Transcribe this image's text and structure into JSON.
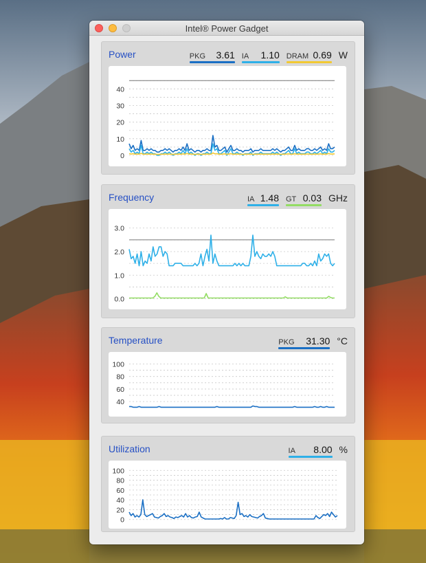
{
  "window": {
    "title": "Intel® Power Gadget"
  },
  "colors": {
    "pkg": "#1a6fc4",
    "ia": "#2eb0e8",
    "dram": "#f2c933",
    "gt": "#93dd63",
    "title_blue": "#2650c4"
  },
  "panels": {
    "power": {
      "title": "Power",
      "unit": "W",
      "readouts": [
        {
          "label": "PKG",
          "value": "3.61"
        },
        {
          "label": "IA",
          "value": "1.10"
        },
        {
          "label": "DRAM",
          "value": "0.69"
        }
      ],
      "chart_data": {
        "type": "line",
        "yticks": [
          "0",
          "10",
          "20",
          "30",
          "40"
        ],
        "ylim": [
          0,
          48
        ],
        "threshold": 45,
        "series": [
          {
            "key": "pkg",
            "values": [
              7,
              4,
              6,
              3,
              4,
              3,
              9,
              3,
              3,
              4,
              3,
              4,
              3,
              3,
              2,
              2,
              3,
              3,
              4,
              3,
              4,
              3,
              2,
              3,
              3,
              4,
              3,
              5,
              3,
              7,
              3,
              4,
              3,
              2,
              3,
              3,
              2,
              3,
              3,
              4,
              3,
              3,
              12,
              5,
              6,
              3,
              3,
              4,
              5,
              2,
              4,
              6,
              3,
              3,
              4,
              3,
              3,
              2,
              3,
              3,
              3,
              4,
              2,
              3,
              3,
              3,
              4,
              3,
              3,
              3,
              3,
              3,
              4,
              3,
              4,
              3,
              2,
              3,
              3,
              4,
              5,
              3,
              3,
              6,
              3,
              4,
              3,
              3,
              3,
              4,
              4,
              3,
              3,
              4,
              3,
              4,
              5,
              3,
              4,
              3,
              7,
              4,
              4,
              5
            ]
          },
          {
            "key": "ia",
            "values": [
              4,
              2,
              3,
              1,
              2,
              1,
              6,
              1,
              1,
              2,
              1,
              2,
              1,
              1,
              0,
              0,
              1,
              1,
              2,
              1,
              2,
              1,
              0,
              1,
              1,
              2,
              1,
              3,
              1,
              4,
              1,
              2,
              1,
              0,
              1,
              1,
              0,
              1,
              1,
              2,
              1,
              1,
              7,
              3,
              4,
              1,
              1,
              2,
              3,
              0,
              2,
              4,
              1,
              1,
              2,
              1,
              1,
              0,
              1,
              1,
              1,
              2,
              0,
              1,
              1,
              1,
              2,
              1,
              1,
              1,
              1,
              1,
              2,
              1,
              2,
              1,
              0,
              1,
              1,
              2,
              3,
              1,
              1,
              4,
              1,
              2,
              1,
              1,
              1,
              2,
              2,
              1,
              1,
              2,
              1,
              2,
              3,
              1,
              2,
              1,
              4,
              2,
              2,
              3
            ]
          },
          {
            "key": "dram",
            "values": [
              1,
              0.8,
              1,
              0.7,
              0.8,
              0.7,
              1.2,
              0.7,
              0.7,
              0.8,
              0.7,
              0.8,
              0.7,
              0.7,
              0.6,
              0.6,
              0.7,
              0.7,
              0.8,
              0.7,
              0.8,
              0.7,
              0.6,
              0.7,
              0.7,
              0.8,
              0.7,
              0.9,
              0.7,
              1.1,
              0.7,
              0.8,
              0.7,
              0.6,
              0.7,
              0.7,
              0.6,
              0.7,
              0.7,
              0.8,
              0.7,
              0.7,
              1.5,
              0.9,
              1,
              0.7,
              0.7,
              0.8,
              0.9,
              0.6,
              0.8,
              1,
              0.7,
              0.7,
              0.8,
              0.7,
              0.7,
              0.6,
              0.7,
              0.7,
              0.7,
              0.8,
              0.6,
              0.7,
              0.7,
              0.7,
              0.8,
              0.7,
              0.7,
              0.7,
              0.7,
              0.7,
              0.8,
              0.7,
              0.8,
              0.7,
              0.6,
              0.7,
              0.7,
              0.8,
              0.9,
              0.7,
              0.7,
              1,
              0.7,
              0.8,
              0.7,
              0.7,
              0.7,
              0.8,
              0.8,
              0.7,
              0.7,
              0.8,
              0.7,
              0.8,
              0.9,
              0.7,
              0.8,
              0.7,
              1.1,
              0.8,
              0.8,
              0.9
            ]
          }
        ]
      }
    },
    "frequency": {
      "title": "Frequency",
      "unit": "GHz",
      "readouts": [
        {
          "label": "IA",
          "value": "1.48"
        },
        {
          "label": "GT",
          "value": "0.03"
        }
      ],
      "chart_data": {
        "type": "line",
        "yticks": [
          "0.0",
          "1.0",
          "2.0",
          "3.0"
        ],
        "yvalues": [
          0,
          1,
          2,
          3
        ],
        "ylim": [
          -0.1,
          3.4
        ],
        "threshold": 2.5,
        "series": [
          {
            "key": "ia",
            "values": [
              2.1,
              1.7,
              1.8,
              1.5,
              1.9,
              1.4,
              2.0,
              1.4,
              1.6,
              1.5,
              1.9,
              1.6,
              2.2,
              1.8,
              1.9,
              2.2,
              2.2,
              1.8,
              2.0,
              1.9,
              1.4,
              1.4,
              1.4,
              1.5,
              1.5,
              1.5,
              1.5,
              1.4,
              1.4,
              1.4,
              1.4,
              1.4,
              1.4,
              1.5,
              1.4,
              1.5,
              1.9,
              1.4,
              1.8,
              2.1,
              1.6,
              2.7,
              1.5,
              1.9,
              1.6,
              1.4,
              1.4,
              1.4,
              1.4,
              1.4,
              1.4,
              1.4,
              1.4,
              1.5,
              1.4,
              1.5,
              1.4,
              1.5,
              1.4,
              1.4,
              1.4,
              1.8,
              2.7,
              1.8,
              2.0,
              1.8,
              1.7,
              1.9,
              1.8,
              1.8,
              1.9,
              1.8,
              2.0,
              1.8,
              1.4,
              1.4,
              1.4,
              1.4,
              1.4,
              1.4,
              1.4,
              1.4,
              1.4,
              1.4,
              1.4,
              1.4,
              1.4,
              1.5,
              1.5,
              1.4,
              1.4,
              1.5,
              1.4,
              1.6,
              1.4,
              1.9,
              1.6,
              1.7,
              1.9,
              1.8,
              1.9,
              1.5,
              1.4,
              1.5
            ]
          },
          {
            "key": "gt",
            "values": [
              0.03,
              0.03,
              0.03,
              0.03,
              0.03,
              0.03,
              0.03,
              0.03,
              0.03,
              0.03,
              0.03,
              0.03,
              0.03,
              0.1,
              0.25,
              0.1,
              0.03,
              0.03,
              0.03,
              0.03,
              0.03,
              0.03,
              0.03,
              0.03,
              0.03,
              0.03,
              0.03,
              0.03,
              0.03,
              0.03,
              0.03,
              0.03,
              0.03,
              0.03,
              0.03,
              0.03,
              0.03,
              0.03,
              0.03,
              0.22,
              0.03,
              0.03,
              0.03,
              0.03,
              0.03,
              0.03,
              0.03,
              0.03,
              0.03,
              0.03,
              0.03,
              0.03,
              0.03,
              0.03,
              0.03,
              0.03,
              0.03,
              0.03,
              0.03,
              0.03,
              0.03,
              0.03,
              0.03,
              0.03,
              0.03,
              0.03,
              0.03,
              0.03,
              0.03,
              0.03,
              0.03,
              0.03,
              0.03,
              0.03,
              0.03,
              0.03,
              0.03,
              0.03,
              0.03,
              0.08,
              0.03,
              0.03,
              0.03,
              0.03,
              0.03,
              0.03,
              0.03,
              0.03,
              0.03,
              0.03,
              0.03,
              0.03,
              0.03,
              0.03,
              0.03,
              0.03,
              0.03,
              0.03,
              0.03,
              0.03,
              0.03,
              0.1,
              0.05,
              0.03,
              0.03
            ]
          }
        ]
      }
    },
    "temperature": {
      "title": "Temperature",
      "unit": "°C",
      "readouts": [
        {
          "label": "PKG",
          "value": "31.30"
        }
      ],
      "chart_data": {
        "type": "line",
        "yticks": [
          "40",
          "60",
          "80",
          "100"
        ],
        "yvalues": [
          40,
          60,
          80,
          100
        ],
        "ylim": [
          27,
          106
        ],
        "series": [
          {
            "key": "pkg",
            "values": [
              32,
              32,
              31,
              31,
              31,
              32,
              31,
              31,
              31,
              31,
              31,
              31,
              31,
              31,
              31,
              32,
              31,
              31,
              31,
              31,
              31,
              31,
              31,
              31,
              31,
              31,
              31,
              31,
              31,
              31,
              31,
              31,
              31,
              31,
              31,
              31,
              31,
              31,
              31,
              31,
              31,
              31,
              31,
              31,
              32,
              31,
              31,
              31,
              31,
              31,
              31,
              31,
              31,
              31,
              31,
              31,
              31,
              31,
              31,
              31,
              31,
              31,
              33,
              32,
              32,
              31,
              31,
              31,
              31,
              31,
              31,
              31,
              31,
              31,
              31,
              31,
              31,
              31,
              31,
              31,
              31,
              31,
              31,
              32,
              31,
              31,
              31,
              31,
              31,
              31,
              31,
              31,
              31,
              32,
              31,
              31,
              32,
              31,
              31,
              32,
              31,
              31,
              31,
              31
            ]
          }
        ]
      }
    },
    "utilization": {
      "title": "Utilization",
      "unit": "%",
      "readouts": [
        {
          "label": "IA",
          "value": "8.00"
        }
      ],
      "chart_data": {
        "type": "line",
        "yticks": [
          "0",
          "20",
          "40",
          "60",
          "80",
          "100"
        ],
        "yvalues": [
          0,
          20,
          40,
          60,
          80,
          100
        ],
        "ylim": [
          -6,
          106
        ],
        "series": [
          {
            "key": "pkg",
            "values": [
              15,
              8,
              12,
              5,
              8,
              5,
              10,
              40,
              10,
              6,
              8,
              10,
              12,
              5,
              4,
              3,
              6,
              8,
              12,
              6,
              8,
              5,
              4,
              2,
              5,
              4,
              6,
              8,
              5,
              12,
              5,
              8,
              4,
              3,
              5,
              6,
              15,
              5,
              3,
              1,
              1,
              1,
              1,
              1,
              1,
              1,
              1,
              2,
              1,
              4,
              1,
              1,
              4,
              3,
              2,
              8,
              35,
              10,
              12,
              6,
              8,
              5,
              10,
              6,
              5,
              4,
              3,
              6,
              8,
              12,
              3,
              2,
              1,
              1,
              1,
              1,
              1,
              1,
              1,
              1,
              1,
              1,
              1,
              1,
              1,
              1,
              1,
              1,
              1,
              1,
              1,
              1,
              1,
              1,
              1,
              1,
              8,
              4,
              2,
              6,
              10,
              8,
              12,
              6,
              15,
              10,
              5,
              8
            ]
          }
        ]
      }
    }
  }
}
